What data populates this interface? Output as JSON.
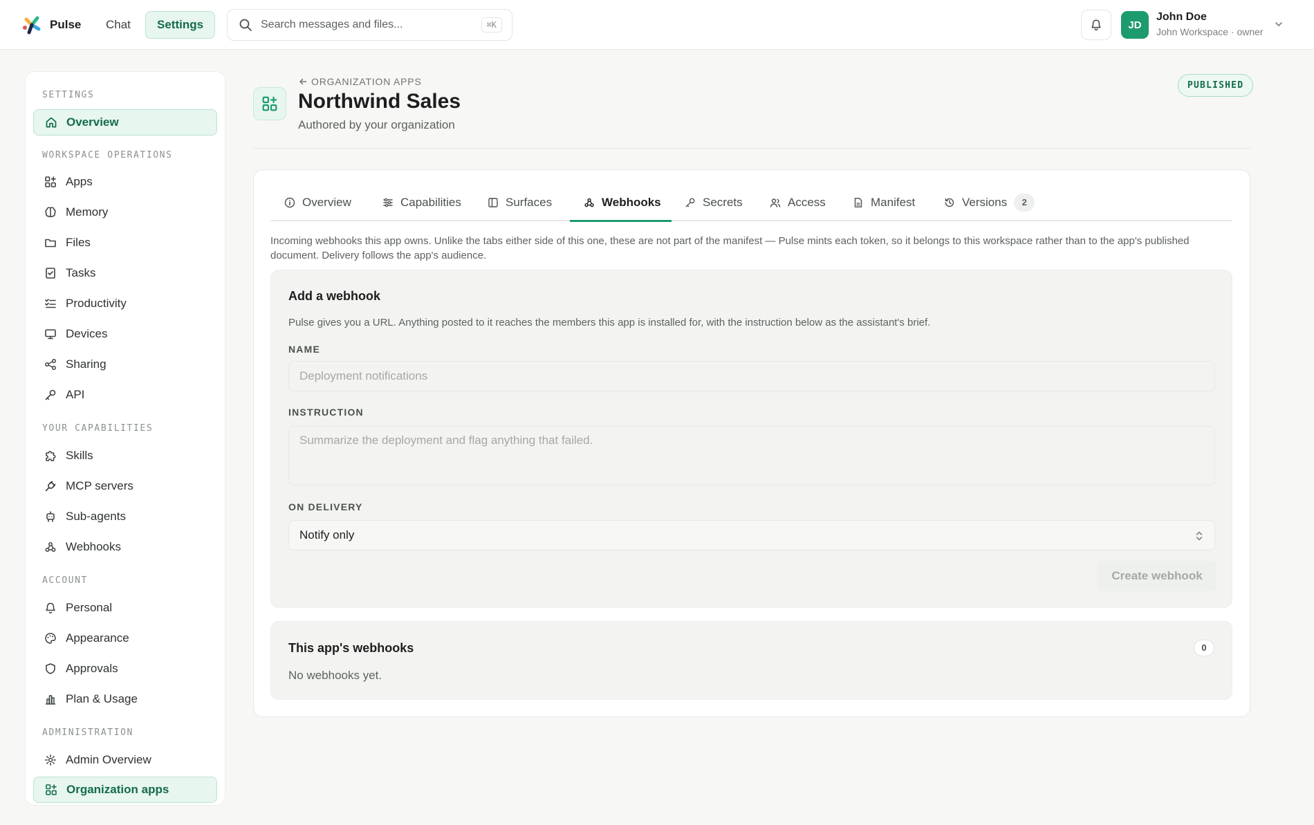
{
  "topbar": {
    "brand": "Pulse",
    "nav": {
      "chat": "Chat",
      "settings": "Settings"
    },
    "search": {
      "placeholder": "Search messages and files...",
      "shortcut": "⌘K"
    },
    "user": {
      "initials": "JD",
      "name": "John Doe",
      "subtitle": "John Workspace · owner"
    }
  },
  "sidebar": {
    "sections": {
      "settings": "SETTINGS",
      "workspace_operations": "WORKSPACE OPERATIONS",
      "your_capabilities": "YOUR CAPABILITIES",
      "account": "ACCOUNT",
      "administration": "ADMINISTRATION"
    },
    "items": {
      "overview": "Overview",
      "apps": "Apps",
      "memory": "Memory",
      "files": "Files",
      "tasks": "Tasks",
      "productivity": "Productivity",
      "devices": "Devices",
      "sharing": "Sharing",
      "api": "API",
      "skills": "Skills",
      "mcp_servers": "MCP servers",
      "sub_agents": "Sub-agents",
      "webhooks": "Webhooks",
      "personal": "Personal",
      "appearance": "Appearance",
      "approvals": "Approvals",
      "plan_usage": "Plan & Usage",
      "admin_overview": "Admin Overview",
      "organization_apps": "Organization apps"
    }
  },
  "header": {
    "back_label": "ORGANIZATION APPS",
    "title": "Northwind Sales",
    "subtitle": "Authored by your organization",
    "status": "PUBLISHED"
  },
  "tabs": {
    "overview": "Overview",
    "capabilities": "Capabilities",
    "surfaces": "Surfaces",
    "webhooks": "Webhooks",
    "secrets": "Secrets",
    "access": "Access",
    "manifest": "Manifest",
    "versions": "Versions",
    "versions_count": "2"
  },
  "webhooks": {
    "intro": "Incoming webhooks this app owns. Unlike the tabs either side of this one, these are not part of the manifest — Pulse mints each token, so it belongs to this workspace rather than to the app's published document. Delivery follows the app's audience.",
    "add": {
      "title": "Add a webhook",
      "description": "Pulse gives you a URL. Anything posted to it reaches the members this app is installed for, with the instruction below as the assistant's brief.",
      "name_label": "NAME",
      "name_placeholder": "Deployment notifications",
      "instruction_label": "INSTRUCTION",
      "instruction_placeholder": "Summarize the deployment and flag anything that failed.",
      "delivery_label": "ON DELIVERY",
      "delivery_value": "Notify only",
      "create_label": "Create webhook"
    },
    "list": {
      "title": "This app's webhooks",
      "count": "0",
      "empty": "No webhooks yet."
    }
  },
  "colors": {
    "accent": "#1c9b6c",
    "accent_bg": "#e7f6ef"
  }
}
